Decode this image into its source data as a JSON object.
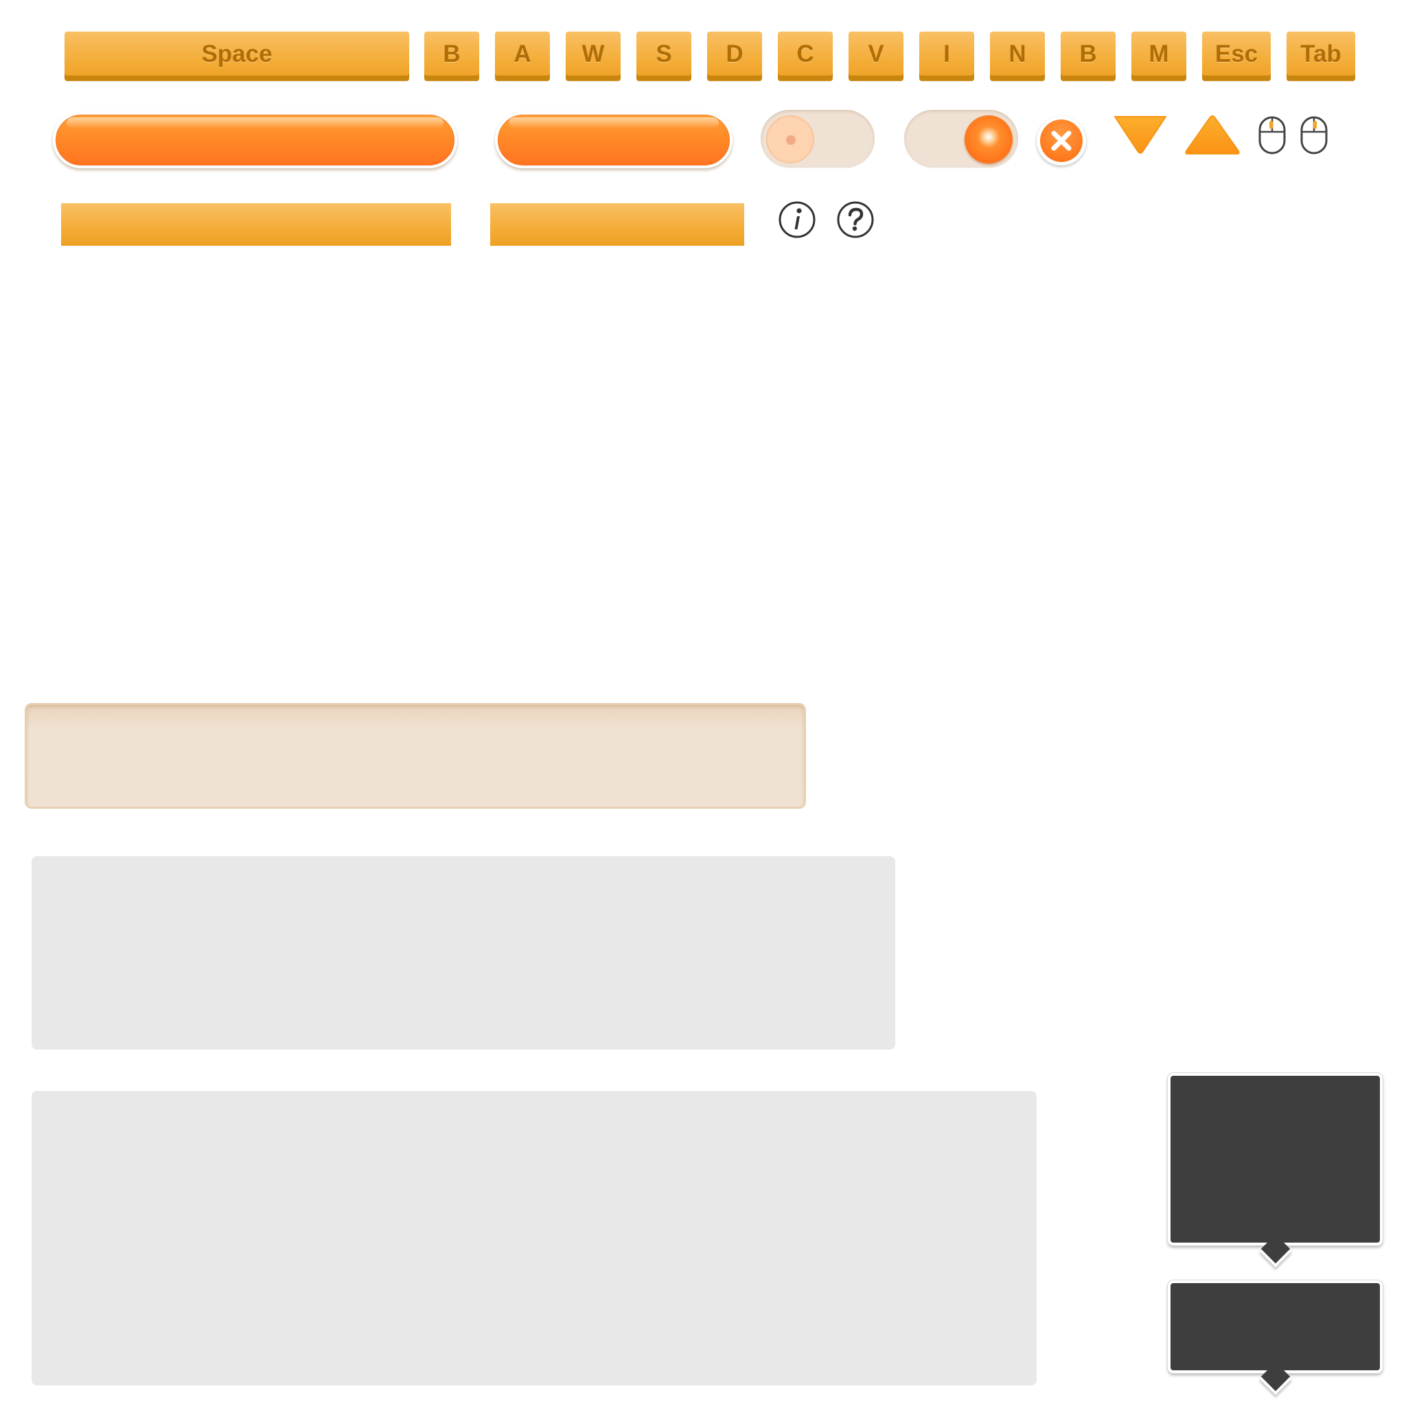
{
  "keys": [
    {
      "label": "Space"
    },
    {
      "label": "B"
    },
    {
      "label": "A"
    },
    {
      "label": "W"
    },
    {
      "label": "S"
    },
    {
      "label": "D"
    },
    {
      "label": "C"
    },
    {
      "label": "V"
    },
    {
      "label": "I"
    },
    {
      "label": "N"
    },
    {
      "label": "B"
    },
    {
      "label": "M"
    },
    {
      "label": "Esc"
    },
    {
      "label": "Tab"
    }
  ],
  "toggles": {
    "first_on": false,
    "second_on": true
  },
  "icons": {
    "close": "close-icon",
    "arrow_down": "triangle-down-icon",
    "arrow_up": "triangle-up-icon",
    "mouse_left": "mouse-left-click-icon",
    "mouse_right": "mouse-right-click-icon",
    "info": "info-icon",
    "help": "help-icon"
  },
  "colors": {
    "key_orange": "#f4ae3b",
    "key_text": "#b06d06",
    "glossy_orange": "#ff8a26",
    "arrow_orange": "#fca21f",
    "beige": "#efe2d3",
    "panel_grey": "#e8e8e8",
    "tooltip_dark": "#3e3e3e",
    "icon_dark": "#333333"
  }
}
